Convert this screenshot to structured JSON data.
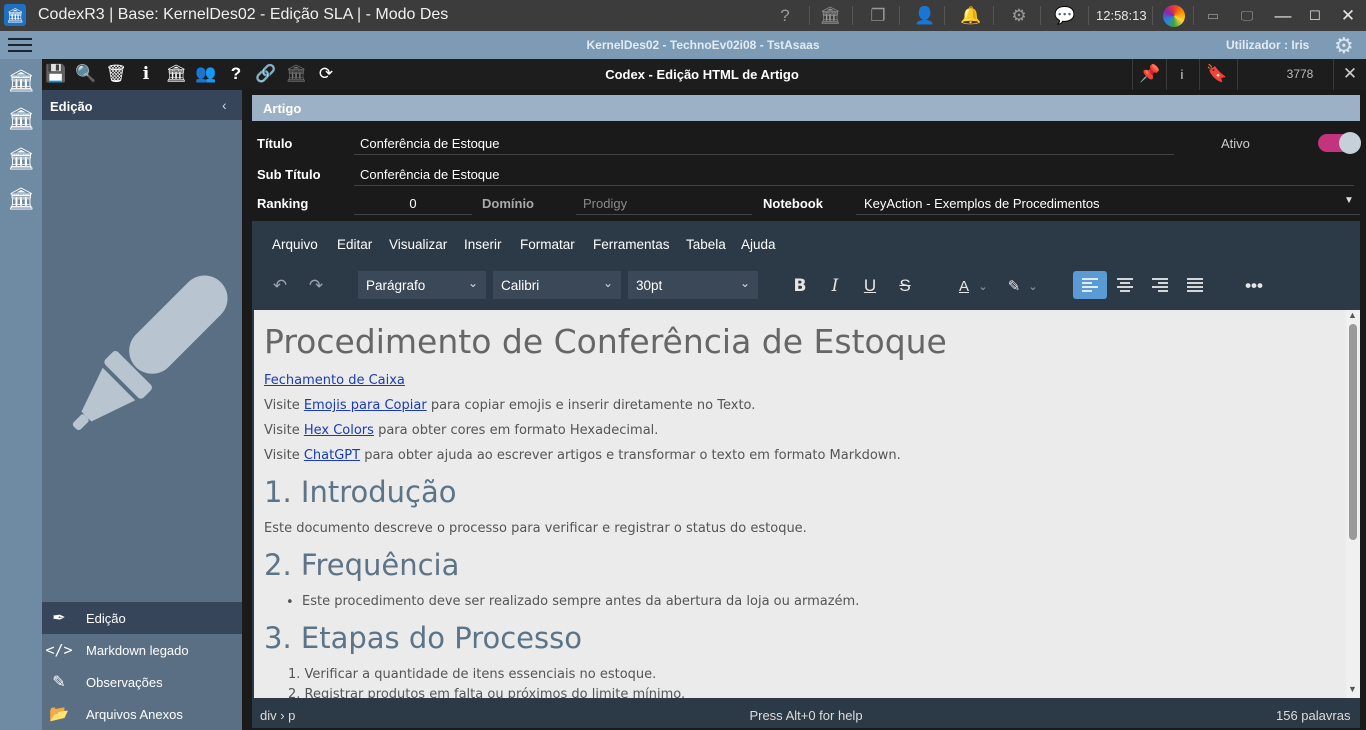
{
  "window": {
    "title": "CodexR3 | Base: KernelDes02 - Edição SLA | - Modo Des",
    "clock": "12:58:13",
    "icons": [
      "help-icon",
      "bank-icon",
      "windows-icon",
      "user-icon",
      "bell-icon",
      "gear-icon",
      "chat-icon",
      "logo-icon",
      "minimize-icon",
      "restore-icon",
      "window-icon",
      "maximize-icon",
      "close-icon"
    ]
  },
  "infobar": {
    "context": "KernelDes02 - TechnoEv02i08 - TstAsaas",
    "user": "Utilizador : Iris"
  },
  "toolbar": {
    "form_title": "Codex - Edição HTML de Artigo",
    "record_id": "3778",
    "info_label": "i"
  },
  "sidebar": {
    "header": "Edição",
    "items": [
      {
        "label": "Edição",
        "icon": "pen-icon",
        "active": true
      },
      {
        "label": "Markdown legado",
        "icon": "code-icon",
        "active": false
      },
      {
        "label": "Observações",
        "icon": "pencil-icon",
        "active": false
      },
      {
        "label": "Arquivos Anexos",
        "icon": "folder-icon",
        "active": false
      }
    ]
  },
  "form": {
    "section": "Artigo",
    "titulo_label": "Título",
    "titulo": "Conferência de Estoque",
    "subtitulo_label": "Sub Título",
    "subtitulo": "Conferência de Estoque",
    "ativo_label": "Ativo",
    "ativo": true,
    "ranking_label": "Ranking",
    "ranking": "0",
    "dominio_label": "Domínio",
    "dominio": "Prodigy",
    "notebook_label": "Notebook",
    "notebook": "KeyAction - Exemplos de Procedimentos"
  },
  "editor": {
    "menus": [
      "Arquivo",
      "Editar",
      "Visualizar",
      "Inserir",
      "Formatar",
      "Ferramentas",
      "Tabela",
      "Ajuda"
    ],
    "block_format": "Parágrafo",
    "font_family": "Calibri",
    "font_size": "30pt",
    "accent_color": "#5b9bd5"
  },
  "document": {
    "h1": "Procedimento de Conferência de Estoque",
    "link_fechamento": "Fechamento de Caixa",
    "visit": "Visite",
    "link_emojis": "Emojis para Copiar",
    "emojis_tail": "para copiar emojis e inserir diretamente no Texto.",
    "link_hex": "Hex Colors",
    "hex_tail": "para obter cores em formato Hexadecimal.",
    "link_chatgpt": "ChatGPT",
    "chatgpt_tail": "para obter ajuda ao escrever artigos e transformar o texto em formato Markdown.",
    "h2_intro": "1. Introdução",
    "intro_text": "Este documento descreve o processo para verificar e registrar o status do estoque.",
    "h2_freq": "2. Frequência",
    "freq_item": "Este procedimento deve ser realizado sempre antes da abertura da loja ou armazém.",
    "h2_etapas": "3. Etapas do Processo",
    "etapa1": "1. Verificar a quantidade de itens essenciais no estoque.",
    "etapa2": "2. Registrar produtos em falta ou próximos do limite mínimo."
  },
  "status": {
    "path": "div › p",
    "help": "Press Alt+0 for help",
    "words": "156 palavras"
  }
}
